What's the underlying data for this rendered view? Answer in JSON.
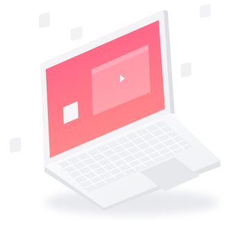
{
  "scene": {
    "subject": "laptop-illustration",
    "colors": {
      "screen_top": "#ff5a86",
      "screen_bottom": "#ff8a8a",
      "body": "#f4f4f5",
      "body_edge": "#e2e3e6",
      "keys": "#ffffff",
      "shadow": "#e9eaee",
      "floating_tile": "#f1f1f3"
    },
    "icons": [
      "play-icon",
      "floating-tile",
      "video-window",
      "keyboard",
      "trackpad"
    ]
  }
}
